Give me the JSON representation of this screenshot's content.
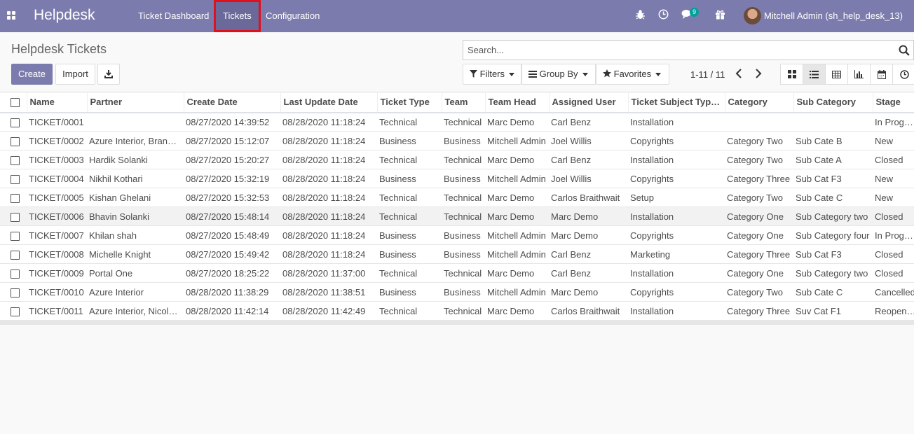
{
  "navbar": {
    "brand": "Helpdesk",
    "menu": [
      {
        "label": "Ticket Dashboard"
      },
      {
        "label": "Tickets"
      },
      {
        "label": "Configuration"
      }
    ],
    "chat_badge": "9",
    "user": "Mitchell Admin (sh_help_desk_13)"
  },
  "control": {
    "title": "Helpdesk Tickets",
    "create_label": "Create",
    "import_label": "Import",
    "search_placeholder": "Search...",
    "filters_label": "Filters",
    "groupby_label": "Group By",
    "favorites_label": "Favorites",
    "pager": "1-11 / 11"
  },
  "table": {
    "columns": [
      "Name",
      "Partner",
      "Create Date",
      "Last Update Date",
      "Ticket Type",
      "Team",
      "Team Head",
      "Assigned User",
      "Ticket Subject Typ…",
      "Category",
      "Sub Category",
      "Stage"
    ],
    "rows": [
      [
        "TICKET/0001",
        "",
        "08/27/2020 14:39:52",
        "08/28/2020 11:18:24",
        "Technical",
        "Technical",
        "Marc Demo",
        "Carl Benz",
        "Installation",
        "",
        "",
        "In Progress"
      ],
      [
        "TICKET/0002",
        "Azure Interior, Brandon Freeman",
        "08/27/2020 15:12:07",
        "08/28/2020 11:18:24",
        "Business",
        "Business",
        "Mitchell Admin",
        "Joel Willis",
        "Copyrights",
        "Category Two",
        "Sub Cate B",
        "New"
      ],
      [
        "TICKET/0003",
        "Hardik Solanki",
        "08/27/2020 15:20:27",
        "08/28/2020 11:18:24",
        "Technical",
        "Technical",
        "Marc Demo",
        "Carl Benz",
        "Installation",
        "Category Two",
        "Sub Cate A",
        "Closed"
      ],
      [
        "TICKET/0004",
        "Nikhil Kothari",
        "08/27/2020 15:32:19",
        "08/28/2020 11:18:24",
        "Business",
        "Business",
        "Mitchell Admin",
        "Joel Willis",
        "Copyrights",
        "Category Three",
        "Sub Cat F3",
        "New"
      ],
      [
        "TICKET/0005",
        "Kishan Ghelani",
        "08/27/2020 15:32:53",
        "08/28/2020 11:18:24",
        "Technical",
        "Technical",
        "Marc Demo",
        "Carlos Braithwait",
        "Setup",
        "Category Two",
        "Sub Cate C",
        "New"
      ],
      [
        "TICKET/0006",
        "Bhavin Solanki",
        "08/27/2020 15:48:14",
        "08/28/2020 11:18:24",
        "Technical",
        "Technical",
        "Marc Demo",
        "Marc Demo",
        "Installation",
        "Category One",
        "Sub Category two",
        "Closed"
      ],
      [
        "TICKET/0007",
        "Khilan shah",
        "08/27/2020 15:48:49",
        "08/28/2020 11:18:24",
        "Business",
        "Business",
        "Mitchell Admin",
        "Marc Demo",
        "Copyrights",
        "Category One",
        "Sub Category four",
        "In Progress"
      ],
      [
        "TICKET/0008",
        "Michelle Knight",
        "08/27/2020 15:49:42",
        "08/28/2020 11:18:24",
        "Business",
        "Business",
        "Mitchell Admin",
        "Carl Benz",
        "Marketing",
        "Category Three",
        "Sub Cat F3",
        "Closed"
      ],
      [
        "TICKET/0009",
        "Portal One",
        "08/27/2020 18:25:22",
        "08/28/2020 11:37:00",
        "Technical",
        "Technical",
        "Marc Demo",
        "Carl Benz",
        "Installation",
        "Category One",
        "Sub Category two",
        "Closed"
      ],
      [
        "TICKET/0010",
        "Azure Interior",
        "08/28/2020 11:38:29",
        "08/28/2020 11:38:51",
        "Business",
        "Business",
        "Mitchell Admin",
        "Marc Demo",
        "Copyrights",
        "Category Two",
        "Sub Cate C",
        "Cancelled"
      ],
      [
        "TICKET/0011",
        "Azure Interior, Nicole Ford",
        "08/28/2020 11:42:14",
        "08/28/2020 11:42:49",
        "Technical",
        "Technical",
        "Marc Demo",
        "Carlos Braithwait",
        "Installation",
        "Category Three",
        "Suv Cat F1",
        "Reopened"
      ]
    ]
  },
  "colors": {
    "navbar": "#7c7bad",
    "primary": "#7c7bad",
    "highlight": "#e0111a",
    "badge": "#00a09d"
  }
}
